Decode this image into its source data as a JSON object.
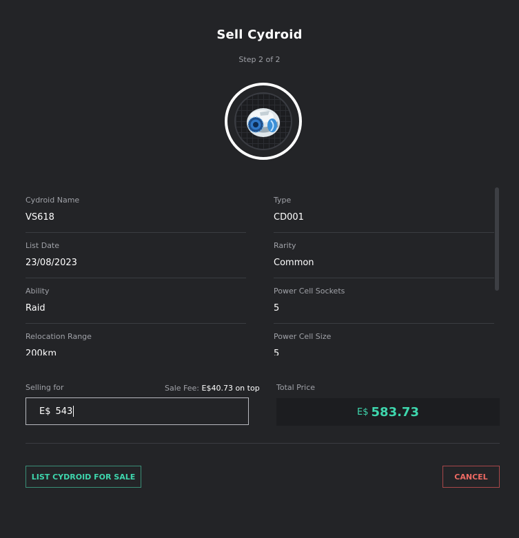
{
  "header": {
    "title": "Sell Cydroid",
    "step": "Step 2 of 2"
  },
  "avatar": {
    "icon": "cydroid-drone-icon"
  },
  "details": {
    "left": [
      {
        "label": "Cydroid Name",
        "value": "VS618"
      },
      {
        "label": "List Date",
        "value": "23/08/2023"
      },
      {
        "label": "Ability",
        "value": "Raid"
      },
      {
        "label": "Relocation Range",
        "value": "200km"
      }
    ],
    "right": [
      {
        "label": "Type",
        "value": "CD001"
      },
      {
        "label": "Rarity",
        "value": "Common"
      },
      {
        "label": "Power Cell Sockets",
        "value": "5"
      },
      {
        "label": "Power Cell Size",
        "value": "5"
      }
    ]
  },
  "selling": {
    "label": "Selling for",
    "fee_prefix": "Sale Fee:",
    "fee_amount": "E$40.73 on top",
    "currency": "E$",
    "value": "543"
  },
  "total": {
    "label": "Total Price",
    "currency": "E$",
    "amount": "583.73"
  },
  "actions": {
    "list_label": "LIST CYDROID FOR SALE",
    "cancel_label": "CANCEL"
  },
  "colors": {
    "background": "#232427",
    "accent": "#3ed6ad",
    "danger": "#ee6a63"
  }
}
